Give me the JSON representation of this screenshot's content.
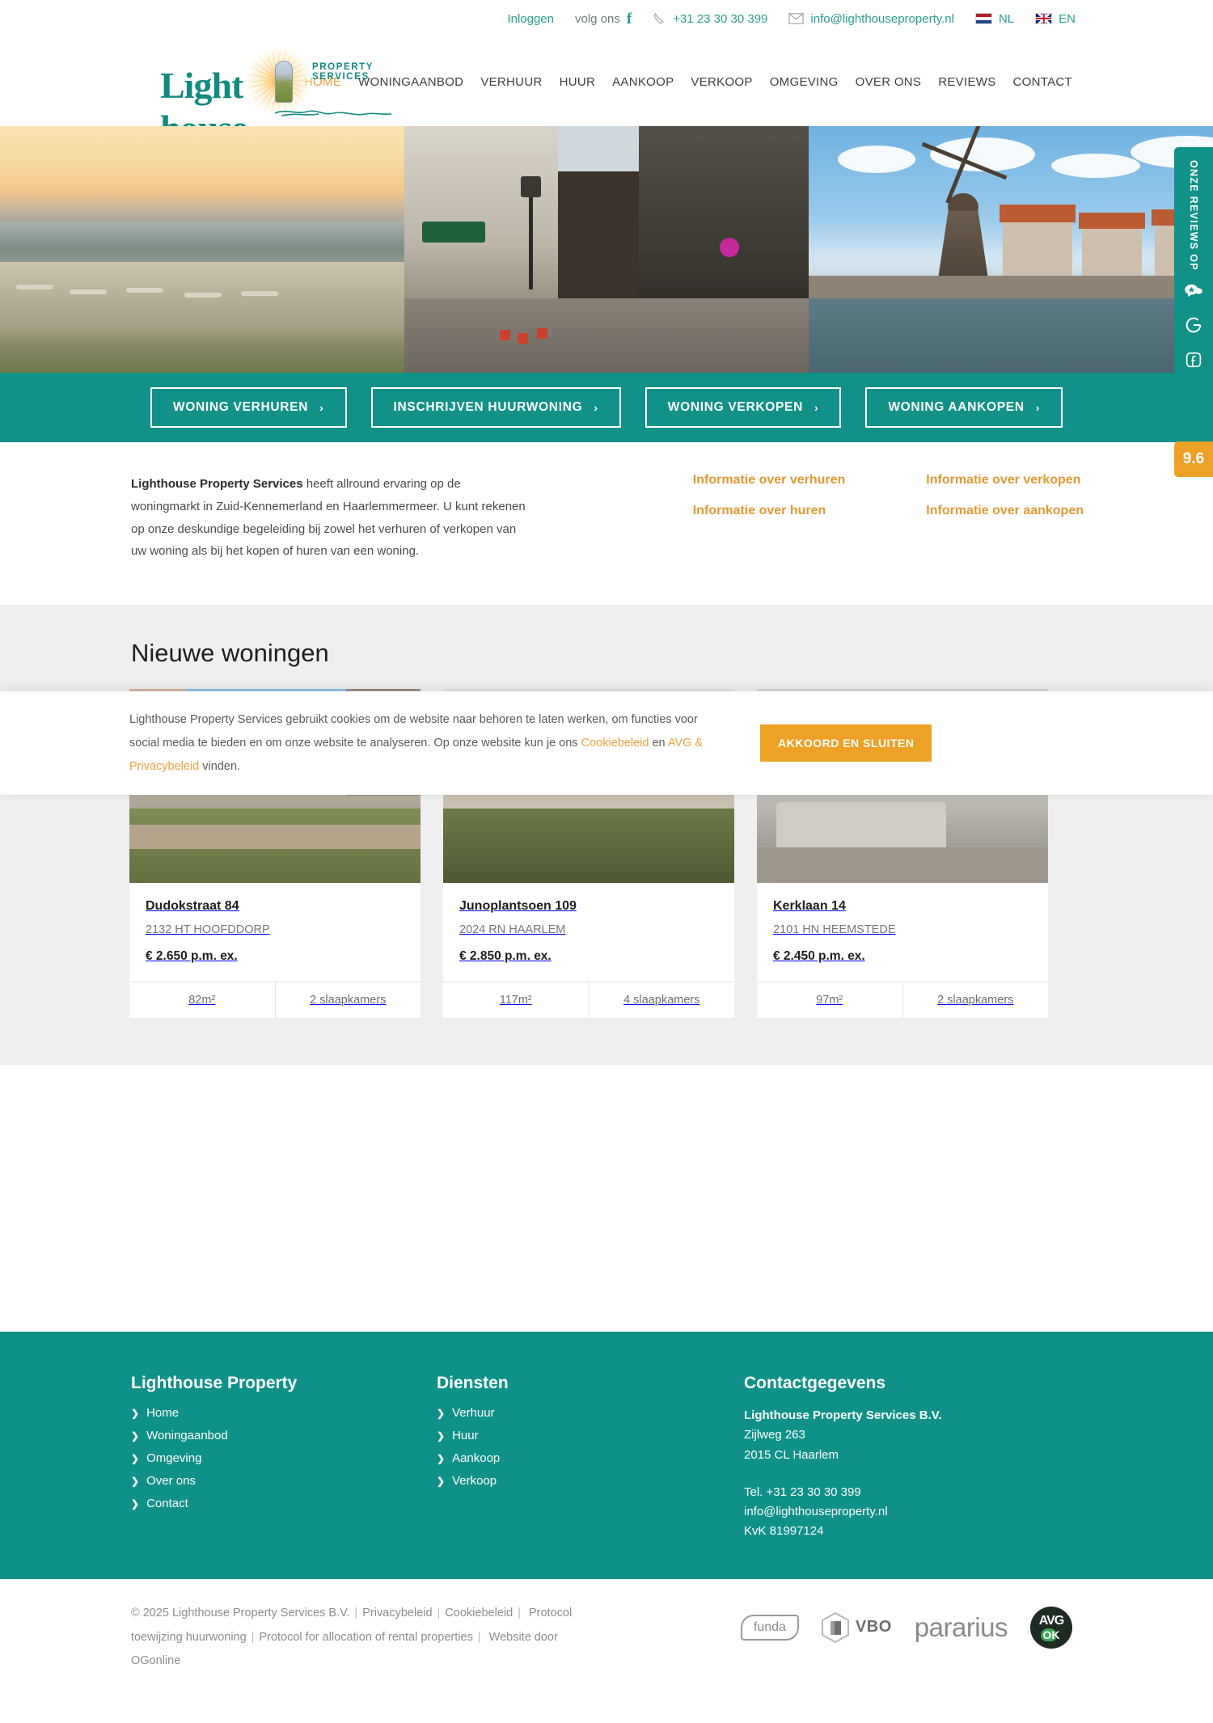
{
  "topbar": {
    "login": "Inloggen",
    "follow_label": "volg ons",
    "facebook_icon": "facebook-icon",
    "phone": "+31 23 30 30 399",
    "email": "info@lighthouseproperty.nl",
    "lang_nl": "NL",
    "lang_en": "EN"
  },
  "logo": {
    "word1": "Light",
    "word2": "house",
    "tagline": "PROPERTY SERVICES"
  },
  "nav": {
    "items": [
      {
        "label": "HOME",
        "active": true
      },
      {
        "label": "WONINGAANBOD",
        "active": false
      },
      {
        "label": "VERHUUR",
        "active": false
      },
      {
        "label": "HUUR",
        "active": false
      },
      {
        "label": "AANKOOP",
        "active": false
      },
      {
        "label": "VERKOOP",
        "active": false
      },
      {
        "label": "OMGEVING",
        "active": false
      },
      {
        "label": "OVER ONS",
        "active": false
      },
      {
        "label": "REVIEWS",
        "active": false
      },
      {
        "label": "CONTACT",
        "active": false
      }
    ]
  },
  "hero": {
    "slides": [
      {
        "alt": "beach-sunrise"
      },
      {
        "alt": "shopping-street"
      },
      {
        "alt": "windmill-canal"
      }
    ]
  },
  "cta": {
    "buttons": [
      {
        "label": "WONING VERHUREN",
        "chevron": "›"
      },
      {
        "label": "INSCHRIJVEN HUURWONING",
        "chevron": "›"
      },
      {
        "label": "WONING VERKOPEN",
        "chevron": "›"
      },
      {
        "label": "WONING AANKOPEN",
        "chevron": "›"
      }
    ]
  },
  "intro": {
    "lead": "Lighthouse Property Services",
    "body": " heeft allround ervaring op de woningmarkt in Zuid-Kennemerland en Haarlemmermeer. U kunt rekenen op onze deskundige begeleiding bij zowel het verhuren of verkopen van uw woning als bij het kopen of huren van een woning.",
    "links_col1": [
      "Informatie over verhuren",
      "Informatie over huren"
    ],
    "links_col2": [
      "Informatie over verkopen",
      "Informatie over aankopen"
    ]
  },
  "listings": {
    "title": "Nieuwe woningen",
    "cards": [
      {
        "title": "Dudokstraat 84",
        "zip": "2132 HT HOOFDDORP",
        "price": "€ 2.650 p.m. ex.",
        "area": "82m²",
        "bedrooms": "2 slaapkamers"
      },
      {
        "title": "Junoplantsoen 109",
        "zip": "2024 RN HAARLEM",
        "price": "€ 2.850 p.m. ex.",
        "area": "117m²",
        "bedrooms": "4 slaapkamers"
      },
      {
        "title": "Kerklaan 14",
        "zip": "2101 HN HEEMSTEDE",
        "price": "€ 2.450 p.m. ex.",
        "area": "97m²",
        "bedrooms": "2 slaapkamers"
      }
    ]
  },
  "review_tab": {
    "label": "ONZE REVIEWS OP",
    "score": "9.6",
    "icons": [
      "review-bubble-icon",
      "google-icon",
      "facebook-square-icon"
    ]
  },
  "cookie": {
    "text_1": "Lighthouse Property Services gebruikt cookies om de website naar behoren te laten werken, om functies voor social media te bieden en om onze website te analyseren. Op onze website kun je ons ",
    "link_1": "Cookiebeleid",
    "text_2": " en ",
    "link_2": "AVG & Privacybeleid",
    "text_3": " vinden.",
    "button": "AKKOORD EN SLUITEN"
  },
  "footer": {
    "col1_title": "Lighthouse Property",
    "col1_items": [
      "Home",
      "Woningaanbod",
      "Omgeving",
      "Over ons",
      "Contact"
    ],
    "col2_title": "Diensten",
    "col2_items": [
      "Verhuur",
      "Huur",
      "Aankoop",
      "Verkoop"
    ],
    "col3_title": "Contactgegevens",
    "company": "Lighthouse Property Services B.V.",
    "street": "Zijlweg 263",
    "city": "2015 CL Haarlem",
    "tel": "Tel. +31 23 30 30 399",
    "email": "info@lighthouseproperty.nl",
    "kvk": "KvK 81997124"
  },
  "bottom": {
    "copyright": "© 2025 Lighthouse Property Services B.V.",
    "links": [
      "Privacybeleid",
      "Cookiebeleid",
      "Protocol toewijzing huurwoning",
      "Protocol for allocation of rental properties",
      "Website door OGonline"
    ],
    "partners": [
      {
        "name": "funda",
        "icon": "funda-logo"
      },
      {
        "name": "VBO",
        "icon": "vbo-logo"
      },
      {
        "name": "pararius",
        "icon": "pararius-logo"
      },
      {
        "name": "AVG OK",
        "icon": "avg-ok-logo"
      }
    ]
  },
  "colors": {
    "teal": "#0f9189",
    "orange": "#e8a33d",
    "cta_orange": "#eda227"
  }
}
